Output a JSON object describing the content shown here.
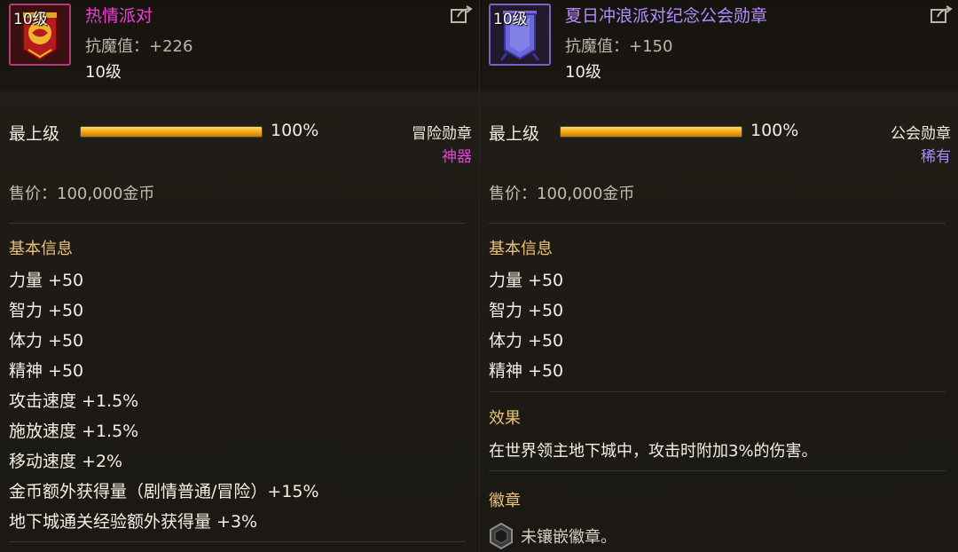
{
  "panels": [
    {
      "id": "left",
      "level_badge": "10级",
      "name": "热情派对",
      "resist": "抗魔值：+226",
      "level": "10级",
      "max_label": "最上级",
      "progress_text": "100%",
      "progress": 1.0,
      "category": "冒险勋章",
      "rarity": "神器",
      "price": "售价：100,000金币",
      "section_basic": "基本信息",
      "stats": [
        "力量 +50",
        "智力 +50",
        "体力 +50",
        "精神 +50",
        "攻击速度 +1.5%",
        "施放速度 +1.5%",
        "移动速度 +2%",
        "金币额外获得量（剧情普通/冒险）+15%",
        "地下城通关经验额外获得量 +3%"
      ]
    },
    {
      "id": "right",
      "level_badge": "10级",
      "name": "夏日冲浪派对纪念公会勋章",
      "resist": "抗魔值：+150",
      "level": "10级",
      "max_label": "最上级",
      "progress_text": "100%",
      "progress": 1.0,
      "category": "公会勋章",
      "rarity": "稀有",
      "price": "售价：100,000金币",
      "section_basic": "基本信息",
      "stats": [
        "力量 +50",
        "智力 +50",
        "体力 +50",
        "精神 +50"
      ],
      "section_effect": "效果",
      "effect": "在世界领主地下城中，攻击时附加3%的伤害。",
      "section_emblem": "徽章",
      "emblem_text": "未镶嵌徽章。"
    }
  ],
  "colors": {
    "artifact": "#ef3fd3",
    "rare": "#b48cff",
    "section": "#e9c278",
    "bar": "#f1a414"
  },
  "icons": [
    "banner-artifact-icon",
    "banner-rare-icon",
    "share-icon",
    "emblem-slot-icon"
  ]
}
